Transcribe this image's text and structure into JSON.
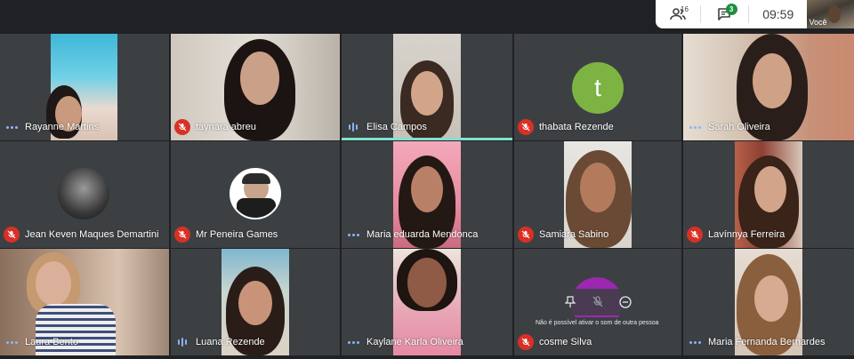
{
  "topbar": {
    "people_count": "16",
    "chat_badge": "3",
    "time": "09:59",
    "self_label": "Você",
    "icons": [
      "people-icon",
      "chat-icon"
    ]
  },
  "participants": [
    {
      "name": "Rayanne Martins",
      "status": "dots"
    },
    {
      "name": "taynara abreu",
      "status": "muted"
    },
    {
      "name": "Elisa Campos",
      "status": "speaking"
    },
    {
      "name": "thabata Rezende",
      "status": "muted",
      "avatar_letter": "t"
    },
    {
      "name": "Sarah Oliveira",
      "status": "dots"
    },
    {
      "name": "Jean Keven Maques Demartini",
      "status": "muted"
    },
    {
      "name": "Mr Peneira Games",
      "status": "muted"
    },
    {
      "name": "Maria eduarda Mendonca",
      "status": "dots"
    },
    {
      "name": "Samiara Sabino",
      "status": "muted"
    },
    {
      "name": "Lavínnya Ferreira",
      "status": "muted"
    },
    {
      "name": "Laura Bento",
      "status": "dots"
    },
    {
      "name": "Luana Rezende",
      "status": "speaking"
    },
    {
      "name": "Kaylane Karla Oliveira",
      "status": "dots"
    },
    {
      "name": "cosme Silva",
      "status": "muted"
    },
    {
      "name": "Maria Fernanda Bernardes",
      "status": "dots"
    }
  ],
  "tooltip": "Não é possível ativar o som de outra pessoa",
  "colors": {
    "background": "#202124",
    "tile": "#3c4043",
    "muted_red": "#d93025",
    "active_teal": "#81e0d0",
    "avatar_green": "#7cb342",
    "cosme_purple": "#9c27b0"
  }
}
